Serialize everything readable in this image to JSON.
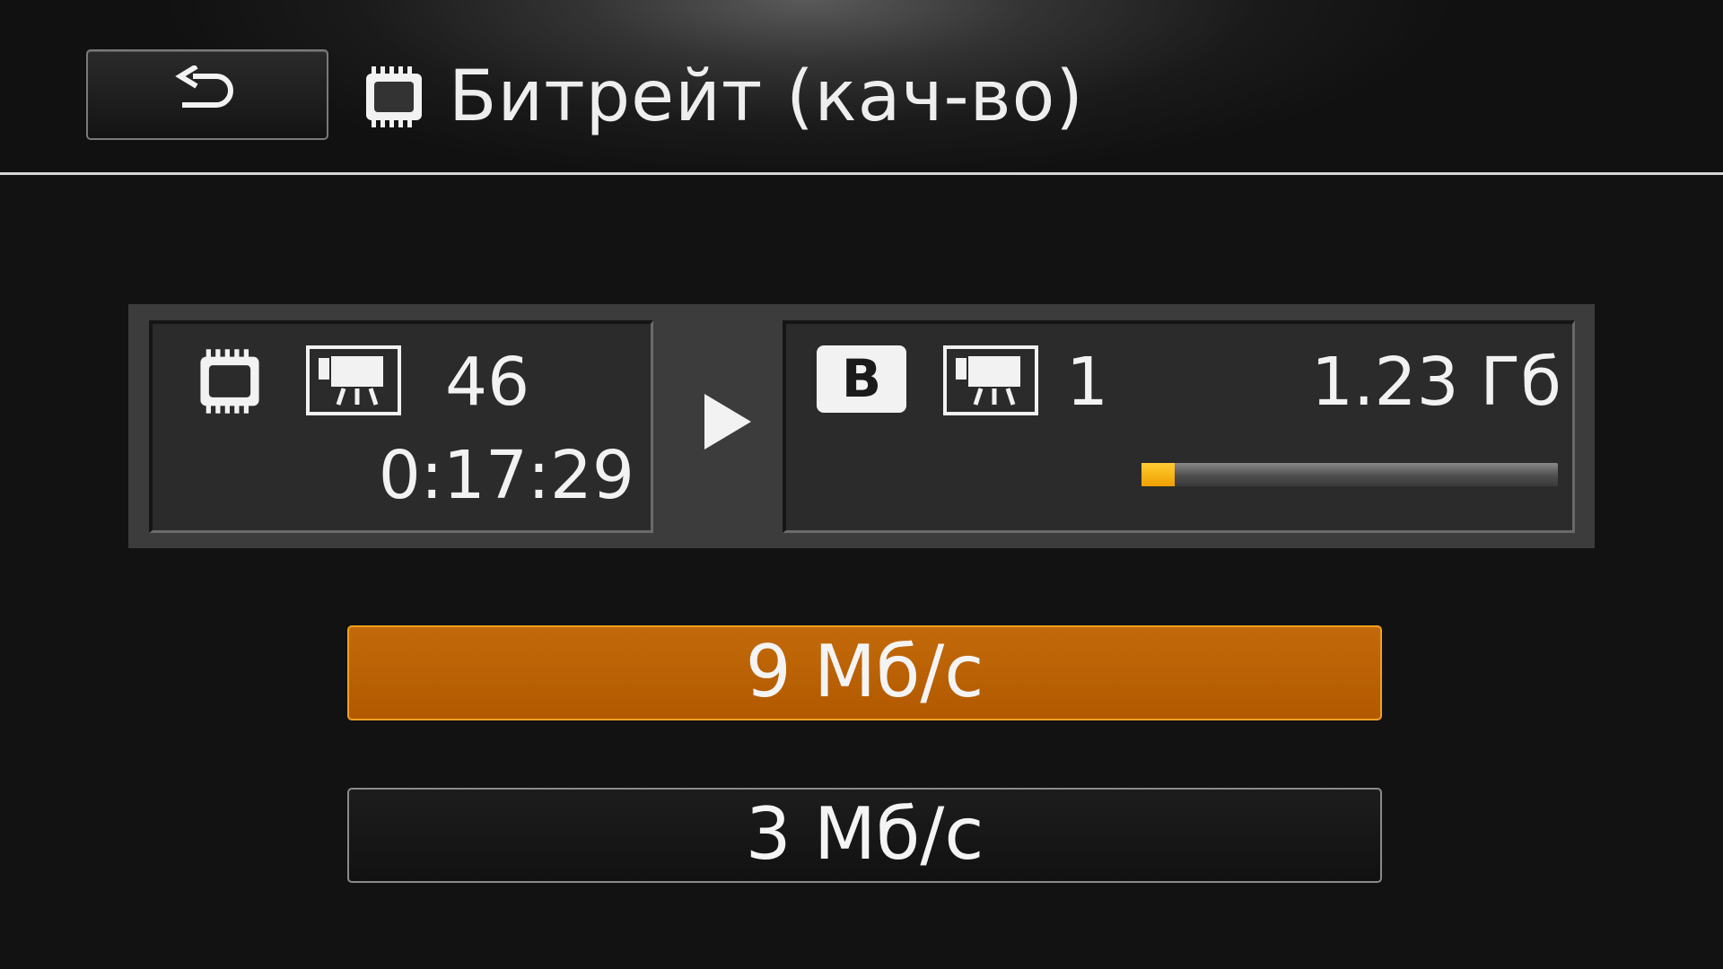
{
  "header": {
    "back_icon": "return-arrow-icon",
    "title_icon": "memory-chip-icon",
    "title": "Битрейт (кач-во)"
  },
  "transfer": {
    "source": {
      "media_icon": "memory-chip-icon",
      "type_icon": "movie-camera-icon",
      "count": "46",
      "duration": "0:17:29"
    },
    "arrow_icon": "play-arrow-icon",
    "destination": {
      "media_icon": "memory-b-icon",
      "media_letter": "B",
      "type_icon": "movie-camera-icon",
      "count": "1",
      "size": "1.23 Гб",
      "used_fraction": 0.08,
      "bar_color": "#f5b000"
    }
  },
  "options": [
    {
      "label": "9 Мб/с",
      "selected": true
    },
    {
      "label": "3 Мб/с",
      "selected": false
    }
  ],
  "colors": {
    "accent": "#b45c00",
    "accent_border": "#f0a020",
    "background": "#121212"
  }
}
